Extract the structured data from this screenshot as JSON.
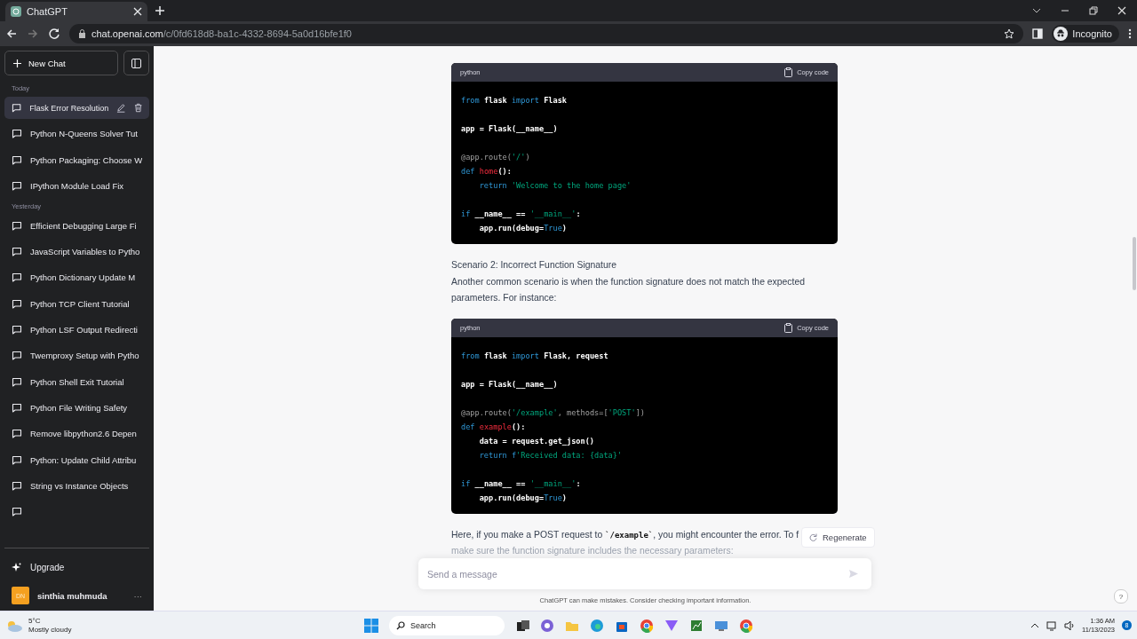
{
  "browser": {
    "tab_title": "ChatGPT",
    "url_host": "chat.openai.com",
    "url_path": "/c/0fd618d8-ba1c-4332-8694-5a0d16bfe1f0",
    "profile": "Incognito"
  },
  "sidebar": {
    "new_chat": "New Chat",
    "groups": [
      {
        "label": "Today",
        "items": [
          {
            "title": "Flask Error Resolution",
            "selected": true
          },
          {
            "title": "Python N-Queens Solver Tut",
            "selected": false
          },
          {
            "title": "Python Packaging: Choose W",
            "selected": false
          },
          {
            "title": "IPython Module Load Fix",
            "selected": false
          }
        ]
      },
      {
        "label": "Yesterday",
        "items": [
          {
            "title": "Efficient Debugging Large Fi",
            "selected": false
          },
          {
            "title": "JavaScript Variables to Pytho",
            "selected": false
          },
          {
            "title": "Python Dictionary Update M",
            "selected": false
          },
          {
            "title": "Python TCP Client Tutorial",
            "selected": false
          },
          {
            "title": "Python LSF Output Redirecti",
            "selected": false
          },
          {
            "title": "Twemproxy Setup with Pytho",
            "selected": false
          },
          {
            "title": "Python Shell Exit Tutorial",
            "selected": false
          },
          {
            "title": "Python File Writing Safety",
            "selected": false
          },
          {
            "title": "Remove libpython2.6 Depen",
            "selected": false
          },
          {
            "title": "Python: Update Child Attribu",
            "selected": false
          },
          {
            "title": "String vs Instance Objects",
            "selected": false
          },
          {
            "selected": false
          }
        ]
      }
    ],
    "upgrade": "Upgrade",
    "user_initials": "DN",
    "user_name": "sinthia muhmuda",
    "more": "···"
  },
  "content": [
    {
      "kind": "code",
      "language": "python",
      "copy": "Copy code",
      "lines": [
        {
          "kind": "code",
          "tokens": [
            {
              "t": "from",
              "kind": "keyword"
            },
            {
              "t": " flask ",
              "kind": "plain"
            },
            {
              "t": "import",
              "kind": "keyword"
            },
            {
              "t": " Flask",
              "kind": "plain"
            }
          ],
          "indented": false
        },
        {
          "kind": "blank"
        },
        {
          "kind": "code",
          "tokens": [
            {
              "t": "app = Flask(__name__)",
              "kind": "plain"
            }
          ],
          "indented": false
        },
        {
          "kind": "blank"
        },
        {
          "kind": "code",
          "tokens": [
            {
              "t": "@app.route(",
              "kind": "decorator"
            },
            {
              "t": "'/'",
              "kind": "string"
            },
            {
              "t": ")",
              "kind": "decorator"
            }
          ],
          "indented": false
        },
        {
          "kind": "code",
          "tokens": [
            {
              "t": "def ",
              "kind": "keyword"
            },
            {
              "t": "home",
              "kind": "function"
            },
            {
              "t": "():",
              "kind": "plain"
            }
          ],
          "indented": false
        },
        {
          "kind": "code",
          "tokens": [
            {
              "t": "return ",
              "kind": "keyword"
            },
            {
              "t": "'Welcome to the home page'",
              "kind": "string"
            }
          ],
          "indented": true
        },
        {
          "kind": "blank"
        },
        {
          "kind": "code",
          "tokens": [
            {
              "t": "if",
              "kind": "keyword"
            },
            {
              "t": " __name__ == ",
              "kind": "plain"
            },
            {
              "t": "'__main__'",
              "kind": "string"
            },
            {
              "t": ":",
              "kind": "plain"
            }
          ],
          "indented": false
        },
        {
          "kind": "code",
          "tokens": [
            {
              "t": "app.run(debug=",
              "kind": "plain"
            },
            {
              "t": "True",
              "kind": "keyword"
            },
            {
              "t": ")",
              "kind": "plain"
            }
          ],
          "indented": true
        }
      ]
    },
    {
      "kind": "paragraph",
      "text": "Scenario 2: Incorrect Function Signature"
    },
    {
      "kind": "paragraph",
      "text": "Another common scenario is when the function signature does not match the expected parameters. For instance:"
    },
    {
      "kind": "code",
      "language": "python",
      "copy": "Copy code",
      "lines": [
        {
          "kind": "code",
          "tokens": [
            {
              "t": "from",
              "kind": "keyword"
            },
            {
              "t": " flask ",
              "kind": "plain"
            },
            {
              "t": "import",
              "kind": "keyword"
            },
            {
              "t": " Flask, request",
              "kind": "plain"
            }
          ],
          "indented": false
        },
        {
          "kind": "blank"
        },
        {
          "kind": "code",
          "tokens": [
            {
              "t": "app = Flask(__name__)",
              "kind": "plain"
            }
          ],
          "indented": false
        },
        {
          "kind": "blank"
        },
        {
          "kind": "code",
          "tokens": [
            {
              "t": "@app.route(",
              "kind": "decorator"
            },
            {
              "t": "'/example'",
              "kind": "string"
            },
            {
              "t": ", methods=[",
              "kind": "decorator"
            },
            {
              "t": "'POST'",
              "kind": "string"
            },
            {
              "t": "])",
              "kind": "decorator"
            }
          ],
          "indented": false
        },
        {
          "kind": "code",
          "tokens": [
            {
              "t": "def ",
              "kind": "keyword"
            },
            {
              "t": "example",
              "kind": "function"
            },
            {
              "t": "():",
              "kind": "plain"
            }
          ],
          "indented": false
        },
        {
          "kind": "code",
          "tokens": [
            {
              "t": "data = request.get_json()",
              "kind": "plain"
            }
          ],
          "indented": true
        },
        {
          "kind": "code",
          "tokens": [
            {
              "t": "return f",
              "kind": "keyword"
            },
            {
              "t": "'Received data: {data}'",
              "kind": "string"
            }
          ],
          "indented": true
        },
        {
          "kind": "blank"
        },
        {
          "kind": "code",
          "tokens": [
            {
              "t": "if",
              "kind": "keyword"
            },
            {
              "t": " __name__ == ",
              "kind": "plain"
            },
            {
              "t": "'__main__'",
              "kind": "string"
            },
            {
              "t": ":",
              "kind": "plain"
            }
          ],
          "indented": false
        },
        {
          "kind": "code",
          "tokens": [
            {
              "t": "app.run(debug=",
              "kind": "plain"
            },
            {
              "t": "True",
              "kind": "keyword"
            },
            {
              "t": ")",
              "kind": "plain"
            }
          ],
          "indented": true
        }
      ]
    },
    {
      "kind": "paragraph",
      "text": "Here, if you make a POST request to **`/example`**, you might encounter the error. To f"
    },
    {
      "kind": "faded",
      "text": "make sure the function signature includes the necessary parameters:"
    }
  ],
  "regenerate": "Regenerate",
  "composer": {
    "placeholder": "Send a message"
  },
  "disclaimer": "ChatGPT can make mistakes. Consider checking important information.",
  "help": "?",
  "taskbar": {
    "temperature": "5°C",
    "weather": "Mostly cloudy",
    "search": "Search",
    "time": "1:36 AM",
    "date": "11/13/2023",
    "notifications": "8"
  }
}
